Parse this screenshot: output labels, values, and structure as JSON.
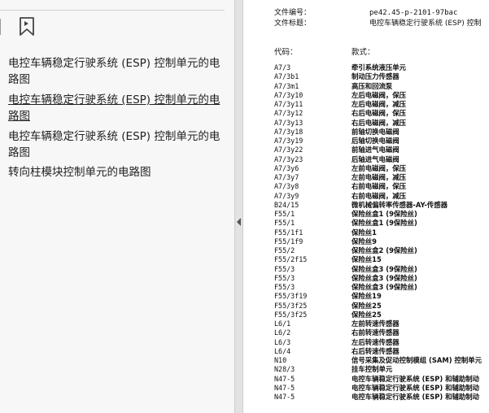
{
  "sidebar": {
    "items": [
      {
        "label": "电控车辆稳定行驶系统 (ESP) 控制单元的电路图"
      },
      {
        "label": "电控车辆稳定行驶系统 (ESP) 控制单元的电路图"
      },
      {
        "label": "电控车辆稳定行驶系统 (ESP) 控制单元的电路图"
      },
      {
        "label": "转向柱模块控制单元的电路图"
      }
    ]
  },
  "document": {
    "doc_number_label": "文件编号：",
    "doc_number_value": "pe42.45-p-2101-97bac",
    "doc_title_label": "文件标题：",
    "doc_title_value": "电控车辆稳定行驶系统 (ESP) 控制",
    "col_code": "代码：",
    "col_desc": "款式：",
    "rows": [
      {
        "code": "A7/3",
        "desc": "牵引系统液压单元"
      },
      {
        "code": "A7/3b1",
        "desc": "制动压力传感器"
      },
      {
        "code": "A7/3m1",
        "desc": "高压和回流泵"
      },
      {
        "code": "A7/3y10",
        "desc": "左后电磁阀，保压"
      },
      {
        "code": "A7/3y11",
        "desc": "左后电磁阀，减压"
      },
      {
        "code": "A7/3y12",
        "desc": "右后电磁阀，保压"
      },
      {
        "code": "A7/3y13",
        "desc": "右后电磁阀，减压"
      },
      {
        "code": "A7/3y18",
        "desc": "前轴切换电磁阀"
      },
      {
        "code": "A7/3y19",
        "desc": "后轴切换电磁阀"
      },
      {
        "code": "A7/3y22",
        "desc": "前轴进气电磁阀"
      },
      {
        "code": "A7/3y23",
        "desc": "后轴进气电磁阀"
      },
      {
        "code": "A7/3y6",
        "desc": "左前电磁阀，保压"
      },
      {
        "code": "A7/3y7",
        "desc": "左前电磁阀，减压"
      },
      {
        "code": "A7/3y8",
        "desc": "右前电磁阀，保压"
      },
      {
        "code": "A7/3y9",
        "desc": "右前电磁阀，减压"
      },
      {
        "code": "B24/15",
        "desc": "微机械偏转率传感器-AY-传感器"
      },
      {
        "code": "F55/1",
        "desc": "保险丝盒1 (9保险丝)"
      },
      {
        "code": "F55/1",
        "desc": "保险丝盒1 (9保险丝)"
      },
      {
        "code": "F55/1f1",
        "desc": "保险丝1"
      },
      {
        "code": "F55/1f9",
        "desc": "保险丝9"
      },
      {
        "code": "F55/2",
        "desc": "保险丝盒2 (9保险丝)"
      },
      {
        "code": "F55/2f15",
        "desc": "保险丝15"
      },
      {
        "code": "F55/3",
        "desc": "保险丝盒3 (9保险丝)"
      },
      {
        "code": "F55/3",
        "desc": "保险丝盒3 (9保险丝)"
      },
      {
        "code": "F55/3",
        "desc": "保险丝盒3 (9保险丝)"
      },
      {
        "code": "F55/3f19",
        "desc": "保险丝19"
      },
      {
        "code": "F55/3f25",
        "desc": "保险丝25"
      },
      {
        "code": "F55/3f25",
        "desc": "保险丝25"
      },
      {
        "code": "L6/1",
        "desc": "左前转速传感器"
      },
      {
        "code": "L6/2",
        "desc": "右前转速传感器"
      },
      {
        "code": "L6/3",
        "desc": "左后转速传感器"
      },
      {
        "code": "L6/4",
        "desc": "右后转速传感器"
      },
      {
        "code": "N10",
        "desc": "信号采集及促动控制模组 (SAM) 控制单元"
      },
      {
        "code": "N28/3",
        "desc": "挂车控制单元"
      },
      {
        "code": "N47-5",
        "desc": "电控车辆稳定行驶系统 (ESP) 和辅助制动"
      },
      {
        "code": "N47-5",
        "desc": "电控车辆稳定行驶系统 (ESP) 和辅助制动"
      },
      {
        "code": "N47-5",
        "desc": "电控车辆稳定行驶系统 (ESP) 和辅助制动"
      }
    ]
  }
}
